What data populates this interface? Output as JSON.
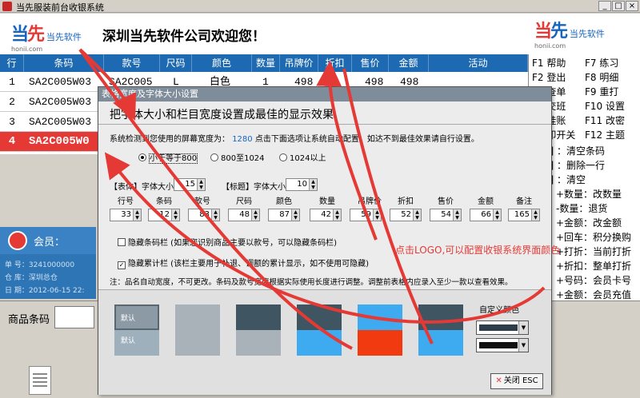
{
  "window": {
    "title": "当先服装前台收银系统",
    "btn_min": "_",
    "btn_max": "□",
    "btn_close": "×"
  },
  "header": {
    "logo_mark_a": "当",
    "logo_mark_b": "先",
    "logo_cn": "当先软件",
    "logo_url": "honii.com",
    "welcome": "深圳当先软件公司欢迎您！",
    "right_logo_mark_a": "当",
    "right_logo_mark_b": "先",
    "right_logo_cn": "当先软件",
    "right_logo_url": "honii.com"
  },
  "table": {
    "headers": [
      "行",
      "条码",
      "款号",
      "尺码",
      "颜色",
      "数量",
      "吊牌价",
      "折扣",
      "售价",
      "金额",
      "活动"
    ],
    "rows": [
      {
        "n": "1",
        "barcode": "SA2C005W03",
        "style": "SA2C005",
        "size": "L",
        "color": "白色",
        "qty": "1",
        "tag": "498",
        "disc": "",
        "price": "498",
        "amount": "498"
      },
      {
        "n": "2",
        "barcode": "SA2C005W03"
      },
      {
        "n": "3",
        "barcode": "SA2C005W03"
      },
      {
        "n": "4",
        "barcode": "SA2C005W0"
      }
    ]
  },
  "shortcuts": {
    "col1": [
      "F1  帮助",
      "F2  登出",
      "F3  查单",
      "F4  交班",
      "F5  挂账",
      "F6  印开关"
    ],
    "col2": [
      "F7  练习",
      "F8  明细",
      "F9  重打",
      "F10 设置",
      "F11 改密",
      "F12 主题"
    ],
    "lines": [
      "[ ]    ：清空条码",
      "[ ]    ：删除一行",
      "[ ]    ：清空",
      "+数量：改数量",
      "-数量：退货",
      "+金额：改金额",
      "+回车：积分换购",
      "+打折：当前打折",
      "+折扣：整单打折",
      "+号码：会员卡号",
      "+金额：会员充值"
    ]
  },
  "member": {
    "title": "会员：",
    "no_label": "单  号：",
    "no_value": "3241000000",
    "store_label": "仓  库：",
    "store_value": "深圳总仓",
    "date_label": "日  期：",
    "date_value": "2012-06-15 22:"
  },
  "barcode": {
    "label": "商品条码"
  },
  "dialog": {
    "title": "表格宽度及字体大小设置",
    "heading": "把字体大小和栏目宽度设置成最佳的显示效果",
    "screen_text_a": "系统检测到您使用的屏幕宽度为：",
    "screen_width": "1280",
    "screen_text_b": "点击下面选项让系统自动配置，如达不到最佳效果请自行设置。",
    "radios": [
      "小于等于800",
      "800至1024",
      "1024以上"
    ],
    "body_label": "【表体】字体大小",
    "body_font": "15",
    "title_label": "【标题】字体大小",
    "title_font": "10",
    "cols": [
      {
        "name": "行号",
        "w": "33"
      },
      {
        "name": "条码",
        "w": "12"
      },
      {
        "name": "款号",
        "w": "83"
      },
      {
        "name": "尺码",
        "w": "48"
      },
      {
        "name": "颜色",
        "w": "87"
      },
      {
        "name": "数量",
        "w": "42"
      },
      {
        "name": "吊牌价",
        "w": "59"
      },
      {
        "name": "折扣",
        "w": "52"
      },
      {
        "name": "售价",
        "w": "54"
      },
      {
        "name": "金额",
        "w": "66"
      },
      {
        "name": "备注",
        "w": "165"
      }
    ],
    "hide_barcode": "隐藏条码栏  (如果您识别商品主要以款号，可以隐藏条码栏)",
    "hide_total": "隐藏累计栏  (该栏主要用于补退、调额的累计显示，如不使用可隐藏)",
    "note": "注：品名自动宽度，不可更改。条码及款号宽度根据实际使用长度进行调整。调整前表格内应录入至少一款以查看效果。",
    "swatch_default_a": "默认",
    "swatch_default_b": "默认",
    "custom_title": "自定义颜色",
    "close": "关闭 ESC"
  },
  "annotation": "点击LOGO,可以配置收银系统界面颜色",
  "colors": {
    "header_blue": "#1e6ab2",
    "selected_red": "#e53935",
    "arrow_red": "#e53935"
  }
}
